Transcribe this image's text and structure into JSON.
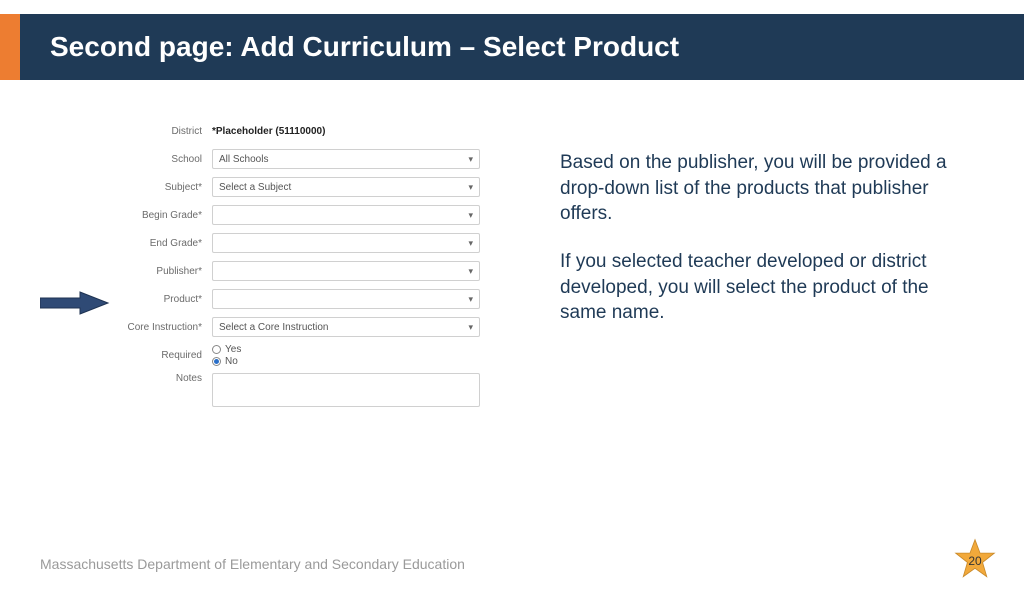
{
  "header": {
    "title": "Second page: Add Curriculum – Select Product"
  },
  "form": {
    "district_label": "District",
    "district_value": "*Placeholder (51110000)",
    "school_label": "School",
    "school_value": "All Schools",
    "subject_label": "Subject*",
    "subject_value": "Select a Subject",
    "begin_grade_label": "Begin Grade*",
    "begin_grade_value": "",
    "end_grade_label": "End Grade*",
    "end_grade_value": "",
    "publisher_label": "Publisher*",
    "publisher_value": "",
    "product_label": "Product*",
    "product_value": "",
    "core_label": "Core Instruction*",
    "core_value": "Select a Core Instruction",
    "required_label": "Required",
    "required_yes": "Yes",
    "required_no": "No",
    "notes_label": "Notes"
  },
  "explain": {
    "p1": "Based on the publisher, you will be provided a drop-down list of the products that publisher offers.",
    "p2": "If you selected teacher developed or district developed, you will select the product of the same name."
  },
  "footer": {
    "org": "Massachusetts Department of Elementary and Secondary Education",
    "page": "20"
  }
}
